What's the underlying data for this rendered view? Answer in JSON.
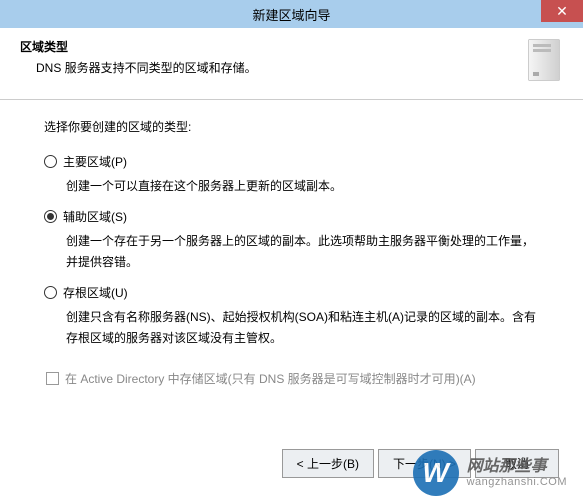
{
  "titlebar": {
    "title": "新建区域向导",
    "close": "✕"
  },
  "header": {
    "title": "区域类型",
    "subtitle": "DNS 服务器支持不同类型的区域和存储。"
  },
  "content": {
    "instruction": "选择你要创建的区域的类型:",
    "options": [
      {
        "label": "主要区域(P)",
        "desc": "创建一个可以直接在这个服务器上更新的区域副本。",
        "checked": false
      },
      {
        "label": "辅助区域(S)",
        "desc": "创建一个存在于另一个服务器上的区域的副本。此选项帮助主服务器平衡处理的工作量，并提供容错。",
        "checked": true
      },
      {
        "label": "存根区域(U)",
        "desc": "创建只含有名称服务器(NS)、起始授权机构(SOA)和粘连主机(A)记录的区域的副本。含有存根区域的服务器对该区域没有主管权。",
        "checked": false
      }
    ],
    "adCheckbox": {
      "label": "在 Active Directory 中存储区域(只有 DNS 服务器是可写域控制器时才可用)(A)",
      "checked": false
    }
  },
  "buttons": {
    "back": "< 上一步(B)",
    "next": "下一步(N) >",
    "cancel": "取消"
  },
  "watermark": {
    "badge": "W",
    "cn": "网站那些事",
    "en": "wangzhanshi.COM"
  }
}
